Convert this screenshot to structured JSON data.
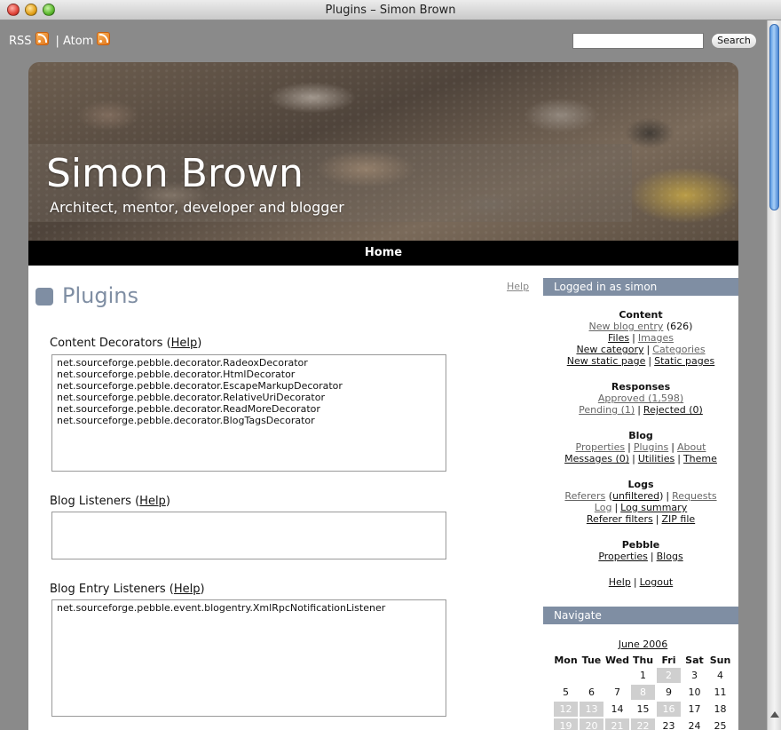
{
  "window": {
    "title": "Plugins – Simon Brown"
  },
  "feeds": {
    "rss_label": "RSS",
    "separator": "|",
    "atom_label": "Atom"
  },
  "search": {
    "value": "",
    "button_label": "Search"
  },
  "header": {
    "title": "Simon Brown",
    "tagline": "Architect, mentor, developer and blogger"
  },
  "nav": {
    "home_label": "Home"
  },
  "page": {
    "title": "Plugins",
    "help_label": "Help",
    "sections": [
      {
        "title": "Content Decorators",
        "help": "Help",
        "items": [
          "net.sourceforge.pebble.decorator.RadeoxDecorator",
          "net.sourceforge.pebble.decorator.HtmlDecorator",
          "net.sourceforge.pebble.decorator.EscapeMarkupDecorator",
          "net.sourceforge.pebble.decorator.RelativeUriDecorator",
          "net.sourceforge.pebble.decorator.ReadMoreDecorator",
          "net.sourceforge.pebble.decorator.BlogTagsDecorator"
        ]
      },
      {
        "title": "Blog Listeners",
        "help": "Help",
        "items": []
      },
      {
        "title": "Blog Entry Listeners",
        "help": "Help",
        "items": [
          "net.sourceforge.pebble.event.blogentry.XmlRpcNotificationListener"
        ]
      }
    ]
  },
  "sidebar": {
    "logged_in_heading": "Logged in as simon",
    "content": {
      "heading": "Content",
      "new_blog_entry": "New blog entry",
      "entry_count": "(626)",
      "files": "Files",
      "images": "Images",
      "new_category": "New category",
      "categories": "Categories",
      "new_static_page": "New static page",
      "static_pages": "Static pages"
    },
    "responses": {
      "heading": "Responses",
      "approved": "Approved (1,598)",
      "pending": "Pending (1)",
      "rejected": "Rejected (0)"
    },
    "blog": {
      "heading": "Blog",
      "properties": "Properties",
      "plugins": "Plugins",
      "about": "About",
      "messages": "Messages (0)",
      "utilities": "Utilities",
      "theme": "Theme"
    },
    "logs": {
      "heading": "Logs",
      "referers": "Referers",
      "unfiltered": "unfiltered",
      "requests": "Requests",
      "log": "Log",
      "log_summary": "Log summary",
      "referer_filters": "Referer filters",
      "zip_file": "ZIP file"
    },
    "pebble": {
      "heading": "Pebble",
      "properties": "Properties",
      "blogs": "Blogs"
    },
    "account": {
      "help": "Help",
      "logout": "Logout"
    },
    "navigate_heading": "Navigate",
    "calendar": {
      "month": "June 2006",
      "days": [
        "Mon",
        "Tue",
        "Wed",
        "Thu",
        "Fri",
        "Sat",
        "Sun"
      ],
      "weeks": [
        [
          "",
          "",
          "",
          "1",
          "2",
          "3",
          "4"
        ],
        [
          "5",
          "6",
          "7",
          "8",
          "9",
          "10",
          "11"
        ],
        [
          "12",
          "13",
          "14",
          "15",
          "16",
          "17",
          "18"
        ],
        [
          "19",
          "20",
          "21",
          "22",
          "23",
          "24",
          "25"
        ]
      ],
      "highlighted": [
        "2",
        "8",
        "12",
        "13",
        "16",
        "19",
        "20",
        "21",
        "22"
      ]
    }
  }
}
